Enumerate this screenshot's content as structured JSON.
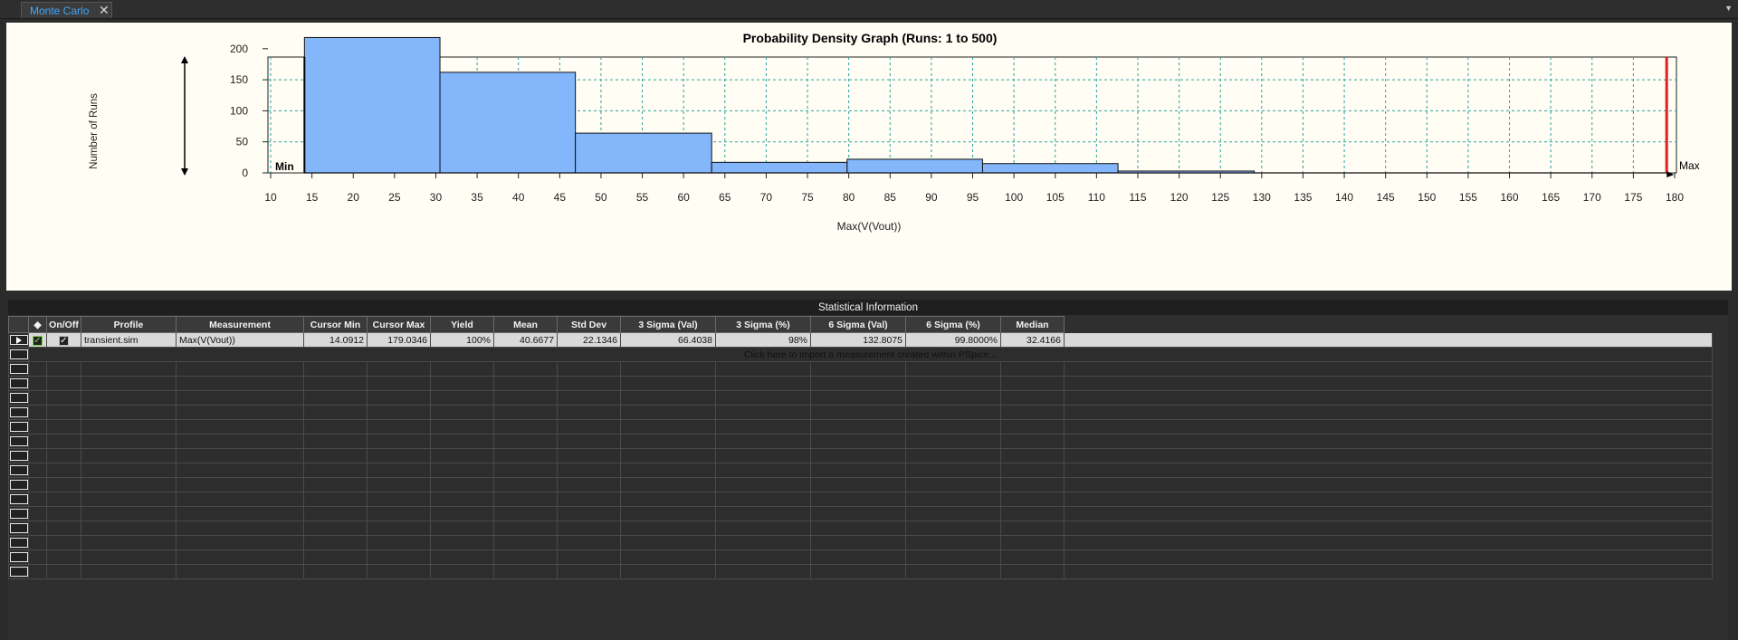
{
  "tab": {
    "label": "Monte Carlo",
    "close": "✕",
    "menu": "▼"
  },
  "graph": {
    "title": "Probability Density Graph (Runs: 1 to 500)",
    "ylabel": "Number of Runs",
    "xlabel": "Max(V(Vout))",
    "min_label": "Min",
    "max_label": "Max"
  },
  "chart_data": {
    "type": "bar",
    "title": "Probability Density Graph (Runs: 1 to 500)",
    "xlabel": "Max(V(Vout))",
    "ylabel": "Number of Runs",
    "xlim": [
      10,
      180
    ],
    "ylim": [
      0,
      230
    ],
    "x_ticks": [
      10,
      15,
      20,
      25,
      30,
      35,
      40,
      45,
      50,
      55,
      60,
      65,
      70,
      75,
      80,
      85,
      90,
      95,
      100,
      105,
      110,
      115,
      120,
      125,
      130,
      135,
      140,
      145,
      150,
      155,
      160,
      165,
      170,
      175,
      180
    ],
    "y_ticks": [
      0,
      50,
      100,
      150,
      200
    ],
    "bins": [
      {
        "x0": 14.0912,
        "x1": 30.5,
        "count": 218
      },
      {
        "x0": 30.5,
        "x1": 46.9,
        "count": 162
      },
      {
        "x0": 46.9,
        "x1": 63.4,
        "count": 64
      },
      {
        "x0": 63.4,
        "x1": 79.8,
        "count": 17
      },
      {
        "x0": 79.8,
        "x1": 96.2,
        "count": 22
      },
      {
        "x0": 96.2,
        "x1": 112.6,
        "count": 15
      },
      {
        "x0": 112.6,
        "x1": 129.1,
        "count": 3
      },
      {
        "x0": 129.1,
        "x1": 179.0346,
        "count": 0
      }
    ],
    "cursor_min": 14.0912,
    "cursor_max": 179.0346,
    "grid": true,
    "colors": {
      "bar": "#84b6fb",
      "max_cursor": "#e02020",
      "background": "#fffdf4"
    }
  },
  "stats": {
    "title": "Statistical Information",
    "columns": [
      "◆",
      "On/Off",
      "Profile",
      "Measurement",
      "Cursor Min",
      "Cursor Max",
      "Yield",
      "Mean",
      "Std Dev",
      "3 Sigma (Val)",
      "3 Sigma (%)",
      "6 Sigma (Val)",
      "6 Sigma (%)",
      "Median"
    ],
    "row": {
      "profile": "transient.sim",
      "measurement": "Max(V(Vout))",
      "cursor_min": "14.0912",
      "cursor_max": "179.0346",
      "yield": "100%",
      "mean": "40.6677",
      "std_dev": "22.1346",
      "sigma3_val": "66.4038",
      "sigma3_pct": "98%",
      "sigma6_val": "132.8075",
      "sigma6_pct": "99.8000%",
      "median": "32.4166"
    },
    "import_hint": "Click here to import a measurement created within PSpice..."
  }
}
